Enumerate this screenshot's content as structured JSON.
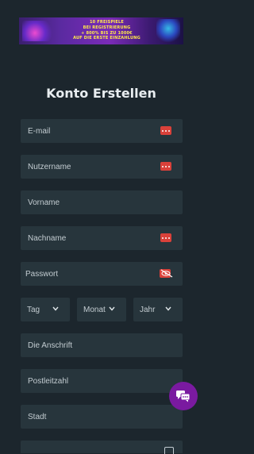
{
  "banner": {
    "lines": [
      "10 FREISPIELE",
      "BEI REGISTRIERUNG",
      "+ 800% BIS ZU 1000€",
      "AUF DIE ERSTE EINZAHLUNG"
    ]
  },
  "form": {
    "title": "Konto Erstellen",
    "email_placeholder": "E-mail",
    "username_placeholder": "Nutzername",
    "firstname_placeholder": "Vorname",
    "lastname_placeholder": "Nachname",
    "password_placeholder": "Passwort",
    "day_label": "Tag",
    "month_label": "Monat",
    "year_label": "Jahr",
    "address_placeholder": "Die Anschrift",
    "zip_placeholder": "Postleitzahl",
    "city_placeholder": "Stadt"
  },
  "colors": {
    "background": "#1c262d",
    "field": "#27353c",
    "badge": "#d9413a",
    "chat_button": "#7a1aa0"
  },
  "icons": {
    "field_badge": "dots-icon",
    "password_toggle": "eye-slash-icon",
    "chevron": "chevron-down-icon",
    "chat": "chat-bubbles-icon"
  }
}
